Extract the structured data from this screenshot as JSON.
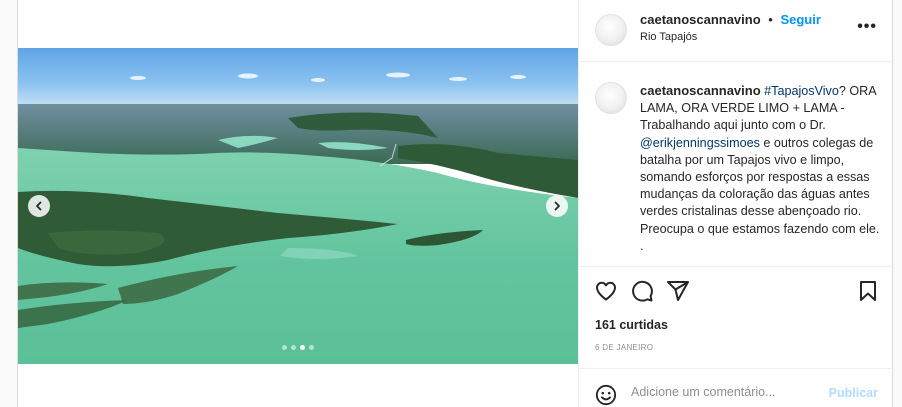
{
  "post": {
    "username": "caetanoscannavino",
    "separator": "•",
    "follow_label": "Seguir",
    "location": "Rio Tapajós",
    "more_label": "•••",
    "caption": {
      "username": "caetanoscannavino",
      "hashtag": "#TapajosVivo",
      "text_1": "? ORA LAMA, ORA VERDE LIMO + LAMA - Trabalhando aqui junto com o Dr. ",
      "mention": "@erikjenningssimoes",
      "text_2": " e outros colegas de batalha por um Tapajos vivo e limpo, somando esforços por respostas a essas mudanças da coloração das águas antes verdes cristalinas desse abençoado rio. Preocupa o que estamos fazendo com ele.",
      "text_3": "."
    },
    "likes": "161 curtidas",
    "date": "6 DE JANEIRO",
    "comment_placeholder": "Adicione um comentário...",
    "publish_label": "Publicar"
  },
  "carousel": {
    "slide_count": 4,
    "active_index": 2
  },
  "colors": {
    "accent": "#0095f6",
    "link": "#00376b",
    "publish_disabled": "#b3dbff",
    "muted": "#8e8e8e",
    "river": "#62c49e"
  },
  "icons": {
    "prev": "chevron-left-icon",
    "next": "chevron-right-icon",
    "like": "heart-icon",
    "comment": "comment-icon",
    "share": "paper-plane-icon",
    "save": "bookmark-icon",
    "emoji": "emoji-icon",
    "more": "more-horizontal-icon"
  }
}
